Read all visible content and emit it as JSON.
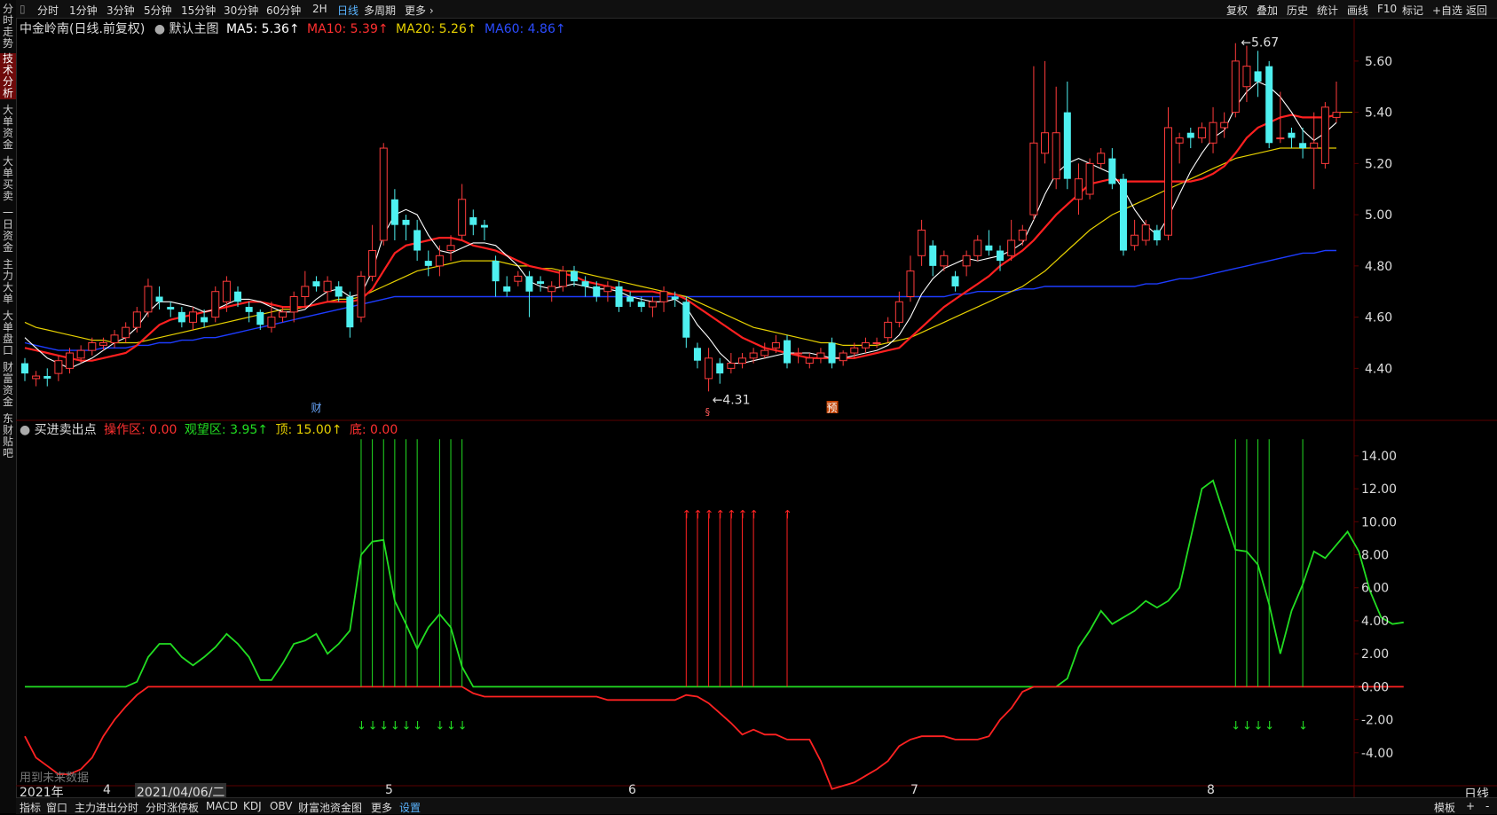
{
  "left_tabs": [
    {
      "label": "分时走势"
    },
    {
      "label": "技术分析",
      "active": true
    },
    {
      "label": "大单资金"
    },
    {
      "label": "大单买卖"
    },
    {
      "label": "一日资金"
    },
    {
      "label": "主力大单"
    },
    {
      "label": "大单盘口"
    },
    {
      "label": "财富资金"
    },
    {
      "label": "东财贴吧"
    }
  ],
  "period_tabs": [
    "分时",
    "1分钟",
    "3分钟",
    "5分钟",
    "15分钟",
    "30分钟",
    "60分钟",
    "2H",
    "日线",
    "多周期",
    "更多 ›"
  ],
  "active_period": "日线",
  "right_tools": [
    "复权",
    "叠加",
    "历史",
    "统计",
    "画线",
    "F10",
    "标记",
    "+自选",
    "返回"
  ],
  "main_info": {
    "stock": "中金岭南(日线.前复权)",
    "template": "默认主图",
    "ma5": "MA5: 5.36↑",
    "ma10": "MA10: 5.39↑",
    "ma20": "MA20: 5.26↑",
    "ma60": "MA60: 4.86↑"
  },
  "indicator_info": {
    "name": "买进卖出点",
    "op": "操作区: 0.00",
    "watch": "观望区: 3.95↑",
    "top": "顶: 15.00↑",
    "bottom": "底: 0.00"
  },
  "annotations": {
    "high": "5.67",
    "low": "4.31",
    "cai": "财",
    "yu": "预",
    "s": "§",
    "future": "用到未来数据"
  },
  "price_axis": [
    "5.60",
    "5.40",
    "5.20",
    "5.00",
    "4.80",
    "4.60",
    "4.40"
  ],
  "ind_axis": [
    "14.00",
    "12.00",
    "10.00",
    "8.00",
    "6.00",
    "4.00",
    "2.00",
    "0.00",
    "-2.00",
    "-4.00"
  ],
  "date_axis": [
    "2021年",
    "4",
    "2021/04/06/二",
    "5",
    "6",
    "7",
    "8"
  ],
  "period_label": "日线",
  "bottom_tabs": [
    "指标",
    "窗口",
    "主力进出分时",
    "分时涨停板",
    "MACD",
    "KDJ",
    "OBV",
    "财富池资金图",
    "更多",
    "设置"
  ],
  "bottom_right": [
    "模板",
    "+",
    "-"
  ],
  "colors": {
    "up": "#ff3b3b",
    "down": "#4ef0f0",
    "ma5": "#ffffff",
    "ma10": "#ff2020",
    "ma20": "#e6d000",
    "ma60": "#1d3cff",
    "green": "#22dd22",
    "red": "#ff2222"
  },
  "chart_data": {
    "type": "candlestick",
    "price_range": [
      4.28,
      5.7
    ],
    "indicator_range": [
      -6.0,
      15.5
    ],
    "candles": [
      [
        4.42,
        4.38,
        4.44,
        4.35
      ],
      [
        4.36,
        4.37,
        4.39,
        4.33
      ],
      [
        4.37,
        4.36,
        4.4,
        4.33
      ],
      [
        4.38,
        4.43,
        4.45,
        4.35
      ],
      [
        4.4,
        4.46,
        4.48,
        4.38
      ],
      [
        4.44,
        4.47,
        4.49,
        4.42
      ],
      [
        4.47,
        4.5,
        4.52,
        4.45
      ],
      [
        4.49,
        4.5,
        4.52,
        4.47
      ],
      [
        4.5,
        4.53,
        4.55,
        4.48
      ],
      [
        4.52,
        4.56,
        4.58,
        4.5
      ],
      [
        4.56,
        4.62,
        4.64,
        4.54
      ],
      [
        4.62,
        4.72,
        4.75,
        4.6
      ],
      [
        4.68,
        4.66,
        4.72,
        4.63
      ],
      [
        4.64,
        4.63,
        4.66,
        4.6
      ],
      [
        4.62,
        4.58,
        4.64,
        4.56
      ],
      [
        4.58,
        4.62,
        4.64,
        4.55
      ],
      [
        4.6,
        4.58,
        4.63,
        4.56
      ],
      [
        4.6,
        4.7,
        4.72,
        4.58
      ],
      [
        4.66,
        4.74,
        4.76,
        4.62
      ],
      [
        4.7,
        4.66,
        4.72,
        4.64
      ],
      [
        4.64,
        4.62,
        4.66,
        4.58
      ],
      [
        4.62,
        4.57,
        4.63,
        4.55
      ],
      [
        4.56,
        4.6,
        4.66,
        4.54
      ],
      [
        4.6,
        4.62,
        4.64,
        4.58
      ],
      [
        4.62,
        4.68,
        4.7,
        4.58
      ],
      [
        4.68,
        4.72,
        4.78,
        4.64
      ],
      [
        4.74,
        4.72,
        4.76,
        4.7
      ],
      [
        4.7,
        4.74,
        4.76,
        4.66
      ],
      [
        4.72,
        4.68,
        4.74,
        4.66
      ],
      [
        4.68,
        4.56,
        4.7,
        4.52
      ],
      [
        4.6,
        4.76,
        4.78,
        4.58
      ],
      [
        4.76,
        4.86,
        4.96,
        4.74
      ],
      [
        4.9,
        5.26,
        5.28,
        4.88
      ],
      [
        5.06,
        4.96,
        5.1,
        4.9
      ],
      [
        4.98,
        4.96,
        5.0,
        4.9
      ],
      [
        4.94,
        4.86,
        4.98,
        4.82
      ],
      [
        4.82,
        4.8,
        4.86,
        4.76
      ],
      [
        4.8,
        4.84,
        4.88,
        4.76
      ],
      [
        4.86,
        4.88,
        4.92,
        4.82
      ],
      [
        4.92,
        5.06,
        5.12,
        4.9
      ],
      [
        4.99,
        4.96,
        5.02,
        4.92
      ],
      [
        4.96,
        4.95,
        4.98,
        4.9
      ],
      [
        4.82,
        4.74,
        4.84,
        4.68
      ],
      [
        4.72,
        4.7,
        4.76,
        4.68
      ],
      [
        4.74,
        4.76,
        4.78,
        4.72
      ],
      [
        4.76,
        4.7,
        4.78,
        4.6
      ],
      [
        4.74,
        4.73,
        4.76,
        4.7
      ],
      [
        4.7,
        4.72,
        4.74,
        4.66
      ],
      [
        4.72,
        4.78,
        4.8,
        4.7
      ],
      [
        4.78,
        4.74,
        4.8,
        4.72
      ],
      [
        4.74,
        4.72,
        4.76,
        4.68
      ],
      [
        4.72,
        4.68,
        4.74,
        4.66
      ],
      [
        4.7,
        4.72,
        4.74,
        4.66
      ],
      [
        4.72,
        4.64,
        4.74,
        4.62
      ],
      [
        4.68,
        4.66,
        4.7,
        4.64
      ],
      [
        4.66,
        4.64,
        4.68,
        4.62
      ],
      [
        4.64,
        4.66,
        4.68,
        4.6
      ],
      [
        4.66,
        4.7,
        4.72,
        4.62
      ],
      [
        4.68,
        4.67,
        4.7,
        4.64
      ],
      [
        4.66,
        4.52,
        4.68,
        4.48
      ],
      [
        4.48,
        4.43,
        4.5,
        4.4
      ],
      [
        4.36,
        4.44,
        4.48,
        4.31
      ],
      [
        4.42,
        4.38,
        4.44,
        4.34
      ],
      [
        4.4,
        4.42,
        4.46,
        4.38
      ],
      [
        4.42,
        4.44,
        4.46,
        4.4
      ],
      [
        4.44,
        4.46,
        4.48,
        4.42
      ],
      [
        4.45,
        4.47,
        4.5,
        4.44
      ],
      [
        4.48,
        4.5,
        4.53,
        4.46
      ],
      [
        4.51,
        4.42,
        4.53,
        4.4
      ],
      [
        4.46,
        4.46,
        4.48,
        4.42
      ],
      [
        4.42,
        4.44,
        4.46,
        4.4
      ],
      [
        4.44,
        4.46,
        4.48,
        4.42
      ],
      [
        4.5,
        4.42,
        4.52,
        4.4
      ],
      [
        4.43,
        4.46,
        4.47,
        4.41
      ],
      [
        4.46,
        4.48,
        4.5,
        4.44
      ],
      [
        4.48,
        4.5,
        4.52,
        4.46
      ],
      [
        4.5,
        4.5,
        4.52,
        4.48
      ],
      [
        4.52,
        4.58,
        4.6,
        4.5
      ],
      [
        4.58,
        4.66,
        4.7,
        4.56
      ],
      [
        4.68,
        4.78,
        4.84,
        4.66
      ],
      [
        4.84,
        4.94,
        4.98,
        4.8
      ],
      [
        4.88,
        4.8,
        4.9,
        4.76
      ],
      [
        4.8,
        4.84,
        4.86,
        4.78
      ],
      [
        4.76,
        4.72,
        4.78,
        4.7
      ],
      [
        4.8,
        4.84,
        4.86,
        4.76
      ],
      [
        4.84,
        4.9,
        4.92,
        4.82
      ],
      [
        4.88,
        4.86,
        4.94,
        4.84
      ],
      [
        4.86,
        4.82,
        4.88,
        4.78
      ],
      [
        4.84,
        4.9,
        4.98,
        4.82
      ],
      [
        4.9,
        4.94,
        4.96,
        4.88
      ],
      [
        5.0,
        5.28,
        5.58,
        4.98
      ],
      [
        5.24,
        5.32,
        5.6,
        5.2
      ],
      [
        5.14,
        5.32,
        5.5,
        5.1
      ],
      [
        5.4,
        5.14,
        5.52,
        5.1
      ],
      [
        5.06,
        5.14,
        5.2,
        5.0
      ],
      [
        5.08,
        5.2,
        5.22,
        5.06
      ],
      [
        5.2,
        5.24,
        5.26,
        5.18
      ],
      [
        5.22,
        5.12,
        5.26,
        5.1
      ],
      [
        5.14,
        4.86,
        5.16,
        4.84
      ],
      [
        4.88,
        4.92,
        4.98,
        4.86
      ],
      [
        4.9,
        4.96,
        4.98,
        4.88
      ],
      [
        4.94,
        4.9,
        4.96,
        4.88
      ],
      [
        4.92,
        5.34,
        5.42,
        4.9
      ],
      [
        5.28,
        5.3,
        5.32,
        5.2
      ],
      [
        5.32,
        5.3,
        5.34,
        5.26
      ],
      [
        5.3,
        5.34,
        5.36,
        5.28
      ],
      [
        5.28,
        5.36,
        5.42,
        5.24
      ],
      [
        5.34,
        5.36,
        5.4,
        5.3
      ],
      [
        5.4,
        5.6,
        5.67,
        5.38
      ],
      [
        5.5,
        5.58,
        5.66,
        5.44
      ],
      [
        5.56,
        5.52,
        5.64,
        5.46
      ],
      [
        5.58,
        5.28,
        5.6,
        5.26
      ],
      [
        5.3,
        5.3,
        5.48,
        5.28
      ],
      [
        5.32,
        5.3,
        5.34,
        5.26
      ],
      [
        5.28,
        5.26,
        5.34,
        5.22
      ],
      [
        5.26,
        5.28,
        5.4,
        5.1
      ],
      [
        5.2,
        5.42,
        5.44,
        5.18
      ],
      [
        5.38,
        5.4,
        5.52,
        5.36
      ]
    ],
    "ma5": [
      4.52,
      4.48,
      4.44,
      4.42,
      4.4,
      4.42,
      4.44,
      4.47,
      4.5,
      4.52,
      4.56,
      4.62,
      4.66,
      4.66,
      4.65,
      4.64,
      4.62,
      4.63,
      4.65,
      4.67,
      4.67,
      4.66,
      4.64,
      4.62,
      4.62,
      4.63,
      4.67,
      4.7,
      4.71,
      4.68,
      4.69,
      4.78,
      4.92,
      5.0,
      5.02,
      5.0,
      4.92,
      4.86,
      4.85,
      4.87,
      4.89,
      4.89,
      4.88,
      4.84,
      4.8,
      4.74,
      4.72,
      4.71,
      4.72,
      4.73,
      4.72,
      4.71,
      4.71,
      4.7,
      4.68,
      4.67,
      4.66,
      4.66,
      4.67,
      4.64,
      4.57,
      4.52,
      4.46,
      4.42,
      4.42,
      4.43,
      4.44,
      4.45,
      4.46,
      4.46,
      4.46,
      4.45,
      4.44,
      4.44,
      4.45,
      4.46,
      4.47,
      4.49,
      4.53,
      4.6,
      4.69,
      4.75,
      4.79,
      4.81,
      4.83,
      4.82,
      4.83,
      4.84,
      4.86,
      4.89,
      4.98,
      5.08,
      5.16,
      5.2,
      5.22,
      5.2,
      5.18,
      5.16,
      5.1,
      5.02,
      4.96,
      4.92,
      4.99,
      5.08,
      5.17,
      5.24,
      5.3,
      5.33,
      5.42,
      5.48,
      5.52,
      5.5,
      5.46,
      5.4,
      5.33,
      5.29,
      5.32,
      5.36
    ],
    "ma10": [
      4.48,
      4.47,
      4.46,
      4.45,
      4.44,
      4.43,
      4.43,
      4.44,
      4.45,
      4.46,
      4.49,
      4.53,
      4.57,
      4.59,
      4.6,
      4.61,
      4.62,
      4.63,
      4.64,
      4.65,
      4.66,
      4.66,
      4.65,
      4.64,
      4.64,
      4.64,
      4.65,
      4.66,
      4.66,
      4.66,
      4.67,
      4.71,
      4.78,
      4.85,
      4.88,
      4.89,
      4.9,
      4.91,
      4.91,
      4.9,
      4.88,
      4.87,
      4.86,
      4.84,
      4.82,
      4.8,
      4.79,
      4.78,
      4.77,
      4.76,
      4.74,
      4.73,
      4.72,
      4.71,
      4.7,
      4.7,
      4.7,
      4.69,
      4.69,
      4.67,
      4.64,
      4.61,
      4.58,
      4.55,
      4.52,
      4.5,
      4.48,
      4.47,
      4.46,
      4.45,
      4.44,
      4.44,
      4.44,
      4.44,
      4.44,
      4.45,
      4.46,
      4.47,
      4.48,
      4.52,
      4.56,
      4.6,
      4.64,
      4.67,
      4.7,
      4.73,
      4.76,
      4.8,
      4.83,
      4.86,
      4.9,
      4.95,
      5.0,
      5.04,
      5.08,
      5.12,
      5.13,
      5.14,
      5.13,
      5.13,
      5.13,
      5.13,
      5.13,
      5.13,
      5.13,
      5.14,
      5.16,
      5.19,
      5.24,
      5.3,
      5.34,
      5.36,
      5.38,
      5.39,
      5.38,
      5.38,
      5.38,
      5.39
    ],
    "ma20": [
      4.58,
      4.56,
      4.55,
      4.54,
      4.53,
      4.52,
      4.51,
      4.51,
      4.5,
      4.5,
      4.5,
      4.51,
      4.52,
      4.53,
      4.54,
      4.55,
      4.56,
      4.57,
      4.58,
      4.59,
      4.6,
      4.61,
      4.62,
      4.63,
      4.63,
      4.64,
      4.65,
      4.66,
      4.67,
      4.67,
      4.68,
      4.7,
      4.72,
      4.74,
      4.76,
      4.78,
      4.79,
      4.8,
      4.81,
      4.82,
      4.82,
      4.82,
      4.82,
      4.81,
      4.8,
      4.8,
      4.79,
      4.79,
      4.78,
      4.78,
      4.77,
      4.76,
      4.75,
      4.74,
      4.73,
      4.72,
      4.71,
      4.7,
      4.69,
      4.68,
      4.66,
      4.64,
      4.62,
      4.6,
      4.58,
      4.56,
      4.55,
      4.54,
      4.53,
      4.52,
      4.51,
      4.5,
      4.5,
      4.49,
      4.49,
      4.49,
      4.49,
      4.5,
      4.51,
      4.52,
      4.54,
      4.56,
      4.58,
      4.6,
      4.62,
      4.64,
      4.66,
      4.68,
      4.7,
      4.72,
      4.75,
      4.78,
      4.82,
      4.86,
      4.9,
      4.94,
      4.97,
      5.0,
      5.02,
      5.04,
      5.06,
      5.08,
      5.1,
      5.12,
      5.14,
      5.16,
      5.18,
      5.2,
      5.22,
      5.23,
      5.24,
      5.25,
      5.26,
      5.26,
      5.26,
      5.26,
      5.26,
      5.26
    ],
    "ma60": [
      4.5,
      4.49,
      4.48,
      4.47,
      4.47,
      4.47,
      4.47,
      4.48,
      4.48,
      4.48,
      4.49,
      4.49,
      4.5,
      4.5,
      4.51,
      4.51,
      4.52,
      4.52,
      4.53,
      4.54,
      4.55,
      4.56,
      4.57,
      4.58,
      4.59,
      4.6,
      4.61,
      4.62,
      4.63,
      4.64,
      4.65,
      4.66,
      4.67,
      4.68,
      4.68,
      4.68,
      4.68,
      4.68,
      4.68,
      4.68,
      4.68,
      4.68,
      4.68,
      4.68,
      4.68,
      4.68,
      4.68,
      4.68,
      4.68,
      4.68,
      4.68,
      4.68,
      4.68,
      4.68,
      4.68,
      4.68,
      4.68,
      4.68,
      4.68,
      4.68,
      4.68,
      4.68,
      4.68,
      4.68,
      4.68,
      4.68,
      4.68,
      4.68,
      4.68,
      4.68,
      4.68,
      4.68,
      4.68,
      4.68,
      4.68,
      4.68,
      4.68,
      4.68,
      4.68,
      4.68,
      4.68,
      4.68,
      4.68,
      4.69,
      4.69,
      4.7,
      4.7,
      4.7,
      4.7,
      4.71,
      4.71,
      4.72,
      4.72,
      4.72,
      4.72,
      4.72,
      4.72,
      4.72,
      4.72,
      4.72,
      4.73,
      4.73,
      4.74,
      4.75,
      4.75,
      4.76,
      4.77,
      4.78,
      4.79,
      4.8,
      4.81,
      4.82,
      4.83,
      4.84,
      4.85,
      4.85,
      4.86,
      4.86
    ],
    "ind_green": [
      0,
      0,
      0,
      0,
      0,
      0,
      0,
      0,
      0,
      0,
      0.3,
      1.8,
      2.6,
      2.6,
      1.8,
      1.3,
      1.8,
      2.4,
      3.2,
      2.6,
      1.8,
      0.4,
      0.4,
      1.4,
      2.6,
      2.8,
      3.2,
      2.0,
      2.6,
      3.4,
      8.0,
      8.8,
      8.9,
      5.2,
      3.8,
      2.3,
      3.6,
      4.4,
      3.6,
      1.2,
      0,
      0,
      0,
      0,
      0,
      0,
      0,
      0,
      0,
      0,
      0,
      0,
      0,
      0,
      0,
      0,
      0,
      0,
      0,
      0,
      0,
      0,
      0,
      0,
      0,
      0,
      0,
      0,
      0,
      0,
      0,
      0,
      0,
      0,
      0,
      0,
      0,
      0,
      0,
      0,
      0,
      0,
      0,
      0,
      0,
      0,
      0,
      0,
      0,
      0,
      0,
      0,
      0,
      0.5,
      2.4,
      3.4,
      4.6,
      3.8,
      4.2,
      4.6,
      5.2,
      4.8,
      5.2,
      6.0,
      9.0,
      12.0,
      12.5,
      10.4,
      8.3,
      8.2,
      7.4,
      5.0,
      2.0,
      4.6,
      6.2,
      8.2,
      7.8,
      8.6,
      9.4,
      8.2,
      5.8,
      4.2,
      3.8,
      3.9
    ],
    "ind_red": [
      -3.0,
      -4.3,
      -4.8,
      -5.3,
      -5.3,
      -5.0,
      -4.3,
      -3.0,
      -2.0,
      -1.2,
      -0.5,
      0,
      0,
      0,
      0,
      0,
      0,
      0,
      0,
      0,
      0,
      0,
      0,
      0,
      0,
      0,
      0,
      0,
      0,
      0,
      0,
      0,
      0,
      0,
      0,
      0,
      0,
      0,
      0,
      0,
      -0.4,
      -0.6,
      -0.6,
      -0.6,
      -0.6,
      -0.6,
      -0.6,
      -0.6,
      -0.6,
      -0.6,
      -0.6,
      -0.6,
      -0.8,
      -0.8,
      -0.8,
      -0.8,
      -0.8,
      -0.8,
      -0.8,
      -0.5,
      -0.6,
      -1.0,
      -1.6,
      -2.2,
      -2.9,
      -2.6,
      -2.9,
      -2.9,
      -3.2,
      -3.2,
      -3.2,
      -4.5,
      -6.2,
      -6.0,
      -5.8,
      -5.4,
      -5.0,
      -4.5,
      -3.6,
      -3.2,
      -3.0,
      -3.0,
      -3.0,
      -3.2,
      -3.2,
      -3.2,
      -3.0,
      -2.0,
      -1.3,
      -0.3,
      0,
      0,
      0,
      0,
      0,
      0,
      0,
      0,
      0,
      0,
      0,
      0,
      0,
      0,
      0,
      0,
      0,
      0,
      0,
      0,
      0,
      0,
      0,
      0,
      0,
      0,
      0,
      0,
      0,
      0,
      0,
      0,
      0,
      0
    ],
    "sell_signals": [
      30,
      31,
      32,
      33,
      34,
      35,
      37,
      38,
      39,
      108,
      109,
      110,
      111,
      114
    ],
    "buy_signals": [
      59,
      60,
      61,
      62,
      63,
      64,
      65,
      68
    ]
  }
}
